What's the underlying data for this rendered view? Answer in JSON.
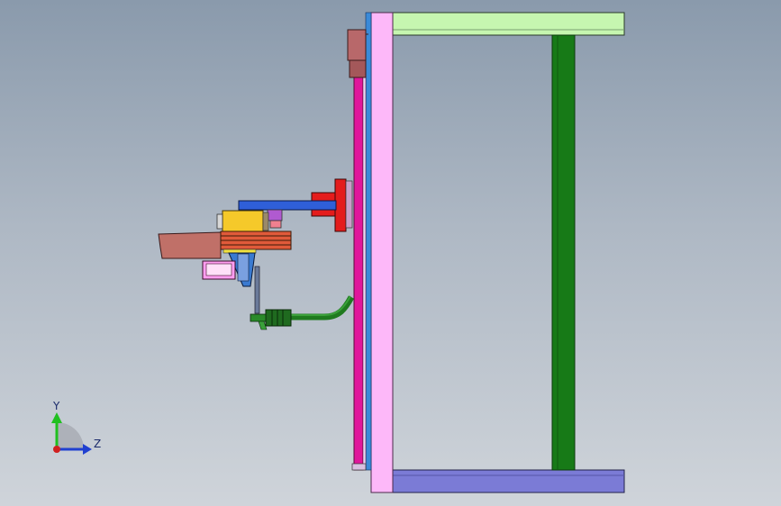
{
  "viewport": {
    "background_top": "#8a9aac",
    "background_bottom": "#cfd4da"
  },
  "model_colors": {
    "top_beam": "#c6f6b0",
    "bottom_beam": "#7b7bd6",
    "vertical_post": "#177a17",
    "main_plate": "#fdb8f9",
    "rail": "#e0169b",
    "rail_edge": "#3a8ad8",
    "cap_block": "#b8686a",
    "arm": "#2f5fd8",
    "mount_flange": "#e41c1c",
    "motor_housing": "#f5c92a",
    "gearbox": "#c07068",
    "stripe_block": "#e05a3a",
    "hopper": "#3a7ad0",
    "hose": "#1f7a1f",
    "small_module": "#ff9ef0"
  },
  "triad": {
    "y_label": "Y",
    "z_label": "Z",
    "y_color": "#20c020",
    "z_color": "#2040d0",
    "origin_color": "#d02020"
  }
}
